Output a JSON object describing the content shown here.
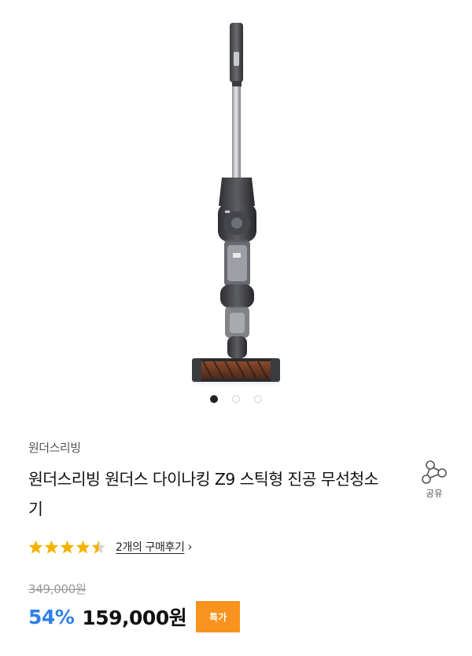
{
  "product": {
    "brand": "원더스리빙",
    "title": "원더스리빙 원더스 다이나킹 Z9 스틱형 진공 무선청소기",
    "image_icon": "stick-vacuum-cleaner-image",
    "carousel": {
      "count": 3,
      "active_index": 0
    }
  },
  "share": {
    "label": "공유",
    "icon": "share-icon"
  },
  "rating": {
    "stars": 4.5,
    "max": 5,
    "star_color": "#f5b301",
    "review_link": "2개의 구매후기",
    "chevron": "›"
  },
  "price": {
    "original": "349,000원",
    "discount": "54%",
    "sale": "159,000원",
    "badge": "특가",
    "accent_color": "#2f7fe6",
    "badge_color": "#f7931e"
  }
}
